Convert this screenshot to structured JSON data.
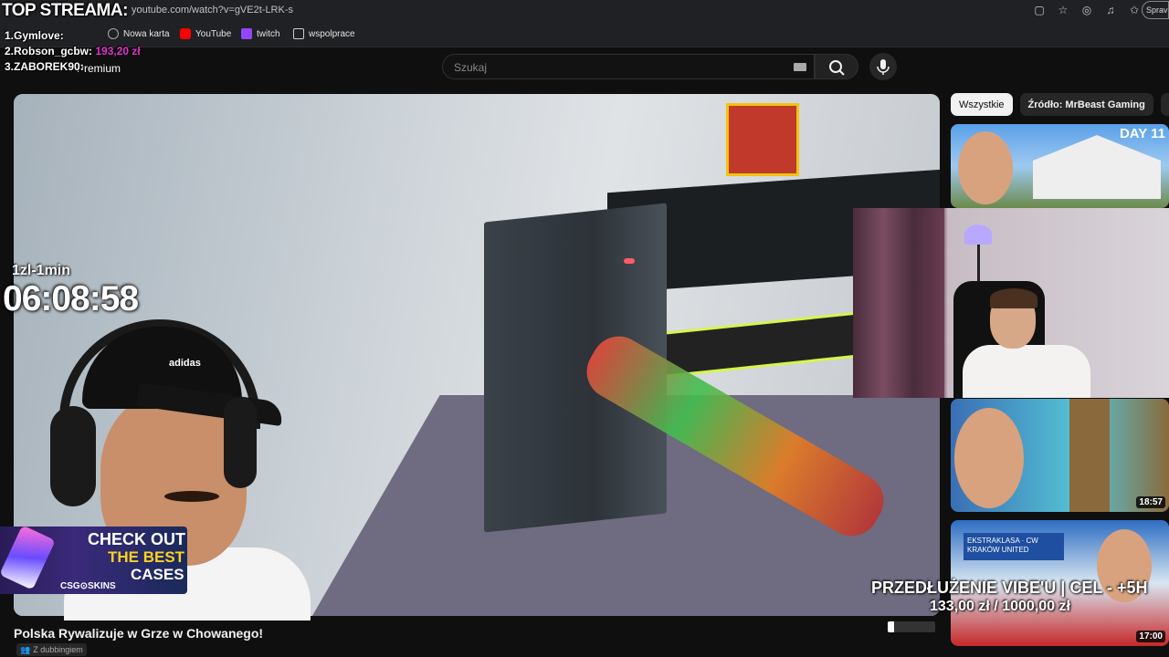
{
  "browser": {
    "url": "youtube.com/watch?v=gVE2t-LRK-s",
    "profile_label": "Sprav",
    "bookmarks": [
      "Nowa karta",
      "YouTube",
      "twitch",
      "wspolprace"
    ]
  },
  "youtube": {
    "logo_text": "Premium",
    "search_placeholder": "Szukaj",
    "video_title": "Polska Rywalizuje w Grze w Chowanego!",
    "dubbing_label": "Z dubbingiem",
    "chips": [
      "Wszystkie",
      "Źródło: MrBeast Gaming",
      "Po"
    ],
    "recommended": [
      {
        "badge": "DAY 11"
      },
      {
        "duration": "18:57"
      },
      {
        "banner": "EKSTRAKLASA · CW KRAKÓW UNITED",
        "duration": "17:00"
      }
    ]
  },
  "overlay": {
    "top_title": "TOP STREAMA:",
    "top_list": [
      {
        "rank_name": "1.Gymlove:",
        "amount": ""
      },
      {
        "rank_name": "2.Robson_gcbw:",
        "amount": "193,20 zł"
      },
      {
        "rank_name": "3.ZABOREK90:",
        "amount": ""
      }
    ],
    "rate": "1zl-1min",
    "timer": "06:08:58",
    "goal_text": "PRZEDŁUŻENIE VIBE'U | CEL - +5H",
    "goal_amount": "133,00 zł / 1000,00 zł",
    "goal_progress": 0.133,
    "sponsor": {
      "line1": "CHECK OUT",
      "line2": "THE BEST",
      "line3": "CASES",
      "brand": "CSG⊙SKINS"
    }
  }
}
